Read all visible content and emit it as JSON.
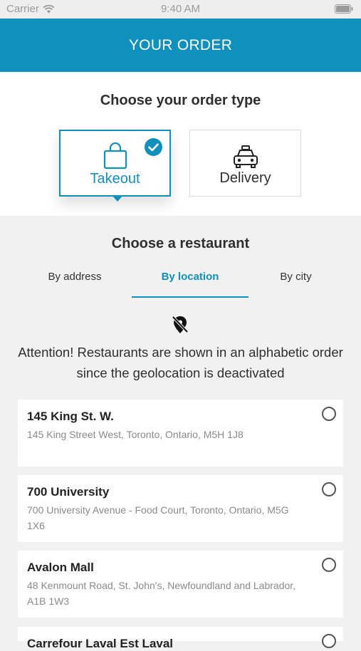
{
  "status_bar": {
    "carrier": "Carrier",
    "time": "9:40 AM"
  },
  "header": {
    "title": "YOUR ORDER"
  },
  "order_type": {
    "title": "Choose your order type",
    "options": [
      {
        "label": "Takeout",
        "icon": "shopping-bag-icon",
        "selected": true
      },
      {
        "label": "Delivery",
        "icon": "car-icon",
        "selected": false
      }
    ]
  },
  "restaurant": {
    "title": "Choose a restaurant",
    "tabs": [
      {
        "label": "By address",
        "active": false
      },
      {
        "label": "By location",
        "active": true
      },
      {
        "label": "By city",
        "active": false
      }
    ],
    "attention": "Attention! Restaurants are shown in an alphabetic order since the geolocation is deactivated",
    "items": [
      {
        "name": "145 King St. W.",
        "address": "145 King Street West, Toronto, Ontario, M5H 1J8"
      },
      {
        "name": "700 University",
        "address": "700 University Avenue - Food Court, Toronto, Ontario, M5G 1X6"
      },
      {
        "name": "Avalon Mall",
        "address": "48 Kenmount Road, St. John's, Newfoundland and Labrador, A1B 1W3"
      },
      {
        "name": "Carrefour Laval Est Laval",
        "address": ""
      }
    ]
  },
  "colors": {
    "accent": "#0f90bd",
    "background": "#f1f1f1"
  }
}
